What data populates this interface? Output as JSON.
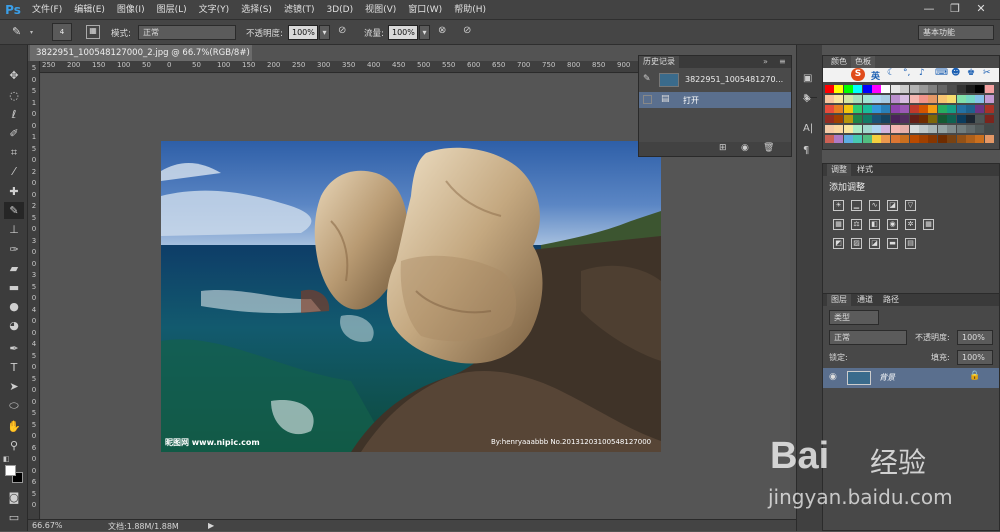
{
  "app": {
    "logo": "Ps"
  },
  "menu": [
    "文件(F)",
    "编辑(E)",
    "图像(I)",
    "图层(L)",
    "文字(Y)",
    "选择(S)",
    "滤镜(T)",
    "3D(D)",
    "视图(V)",
    "窗口(W)",
    "帮助(H)"
  ],
  "window_controls": {
    "minimize": "—",
    "restore": "❐",
    "close": "✕"
  },
  "options": {
    "brush_size": "4",
    "mode_label": "模式:",
    "mode_value": "正常",
    "opacity_label": "不透明度:",
    "opacity_value": "100%",
    "flow_label": "流量:",
    "flow_value": "100%",
    "workspace": "基本功能"
  },
  "document": {
    "tab_title": "3822951_100548127000_2.jpg @ 66.7%(RGB/8#)",
    "close": "×",
    "watermark_left": "昵图网 www.nipic.com",
    "watermark_right": "By:henryaaabbb  No.20131203100548127000"
  },
  "ruler_top": [
    "250",
    "200",
    "150",
    "100",
    "50",
    "0",
    "50",
    "100",
    "150",
    "200",
    "250",
    "300",
    "350",
    "400",
    "450",
    "500",
    "550",
    "600",
    "650",
    "700",
    "750",
    "800",
    "850",
    "900",
    "950",
    "1000",
    "1050",
    "1100"
  ],
  "ruler_left": [
    "5",
    "0",
    "5",
    "1",
    "0",
    "0",
    "1",
    "5",
    "0",
    "2",
    "0",
    "0",
    "2",
    "5",
    "0",
    "3",
    "0",
    "0",
    "3",
    "5",
    "0",
    "4",
    "0",
    "0",
    "4",
    "5",
    "0",
    "5",
    "0",
    "0",
    "5",
    "5",
    "0",
    "6",
    "0",
    "0",
    "6",
    "5",
    "0"
  ],
  "status": {
    "zoom": "66.67%",
    "doc": "文档:1.88M/1.88M",
    "arrow": "▶"
  },
  "history": {
    "title": "历史记录",
    "snapshot": "3822951_1005481270...",
    "items": [
      "打开"
    ]
  },
  "color_panel": {
    "tabs": [
      "颜色",
      "色板"
    ],
    "ime_logo": "S",
    "ime_lang": "英"
  },
  "adjust_panel": {
    "tabs": [
      "调整",
      "样式"
    ],
    "heading": "添加调整"
  },
  "layers_panel": {
    "tabs": [
      "图层",
      "通道",
      "路径"
    ],
    "filter": "类型",
    "blend": "正常",
    "opacity_label": "不透明度:",
    "opacity_value": "100%",
    "lock_label": "锁定:",
    "fill_label": "填充:",
    "fill_value": "100%",
    "layer_name": "背景"
  },
  "watermark": {
    "brand": "Bai",
    "brand2": "经验",
    "url": "jingyan.baidu.com"
  },
  "colors": {
    "fg": "#ffffff",
    "bg": "#000000"
  }
}
